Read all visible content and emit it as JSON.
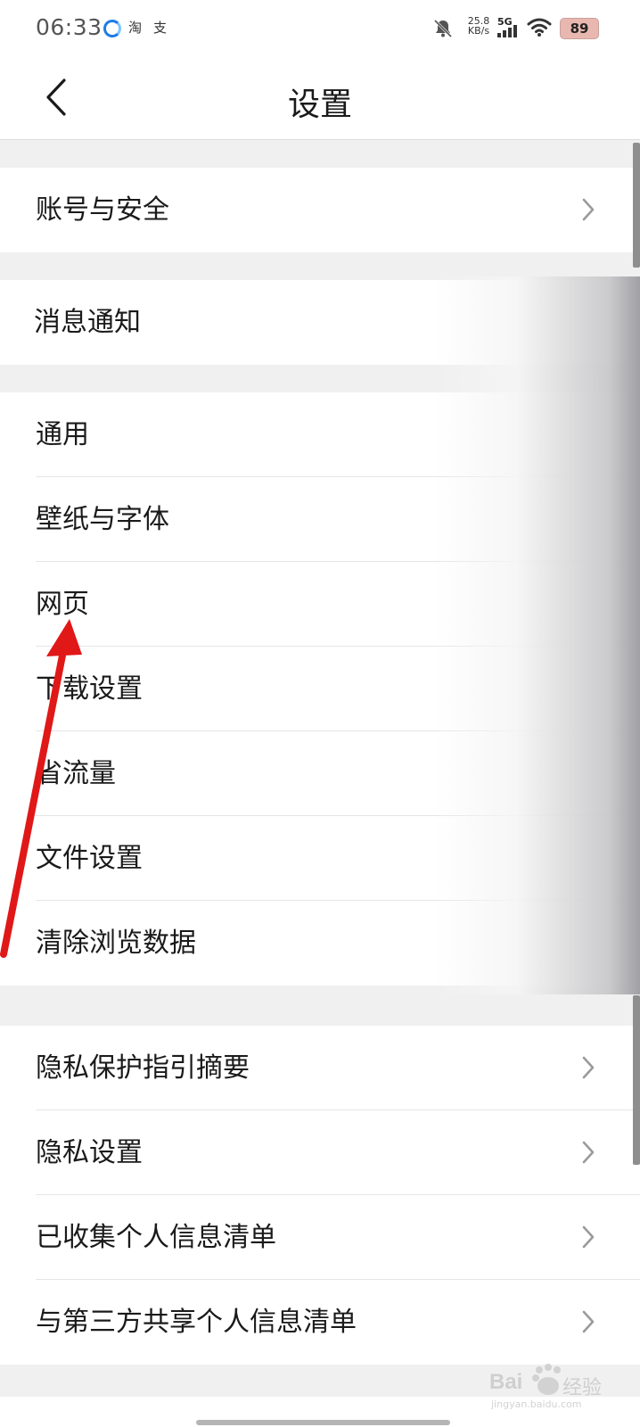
{
  "status_bar": {
    "time": "06:33",
    "app_taobao": "淘",
    "app_alipay": "支",
    "speed_value": "25.8",
    "speed_unit": "KB/s",
    "network": "5G",
    "battery": "89"
  },
  "header": {
    "title": "设置"
  },
  "groups": [
    {
      "items": [
        {
          "label": "账号与安全"
        }
      ]
    },
    {
      "items": [
        {
          "label": "消息通知"
        }
      ]
    },
    {
      "items": [
        {
          "label": "通用"
        },
        {
          "label": "壁纸与字体"
        },
        {
          "label": "网页"
        },
        {
          "label": "下载设置"
        },
        {
          "label": "省流量"
        },
        {
          "label": "文件设置"
        },
        {
          "label": "清除浏览数据"
        }
      ]
    },
    {
      "items": [
        {
          "label": "隐私保护指引摘要"
        },
        {
          "label": "隐私设置"
        },
        {
          "label": "已收集个人信息清单"
        },
        {
          "label": "与第三方共享个人信息清单"
        }
      ]
    }
  ],
  "watermark": {
    "brand": "Bai",
    "brand_cn": "经验",
    "url": "jingyan.baidu.com"
  },
  "colors": {
    "annotation_arrow": "#e01818",
    "chevron": "#9a9a9a"
  }
}
